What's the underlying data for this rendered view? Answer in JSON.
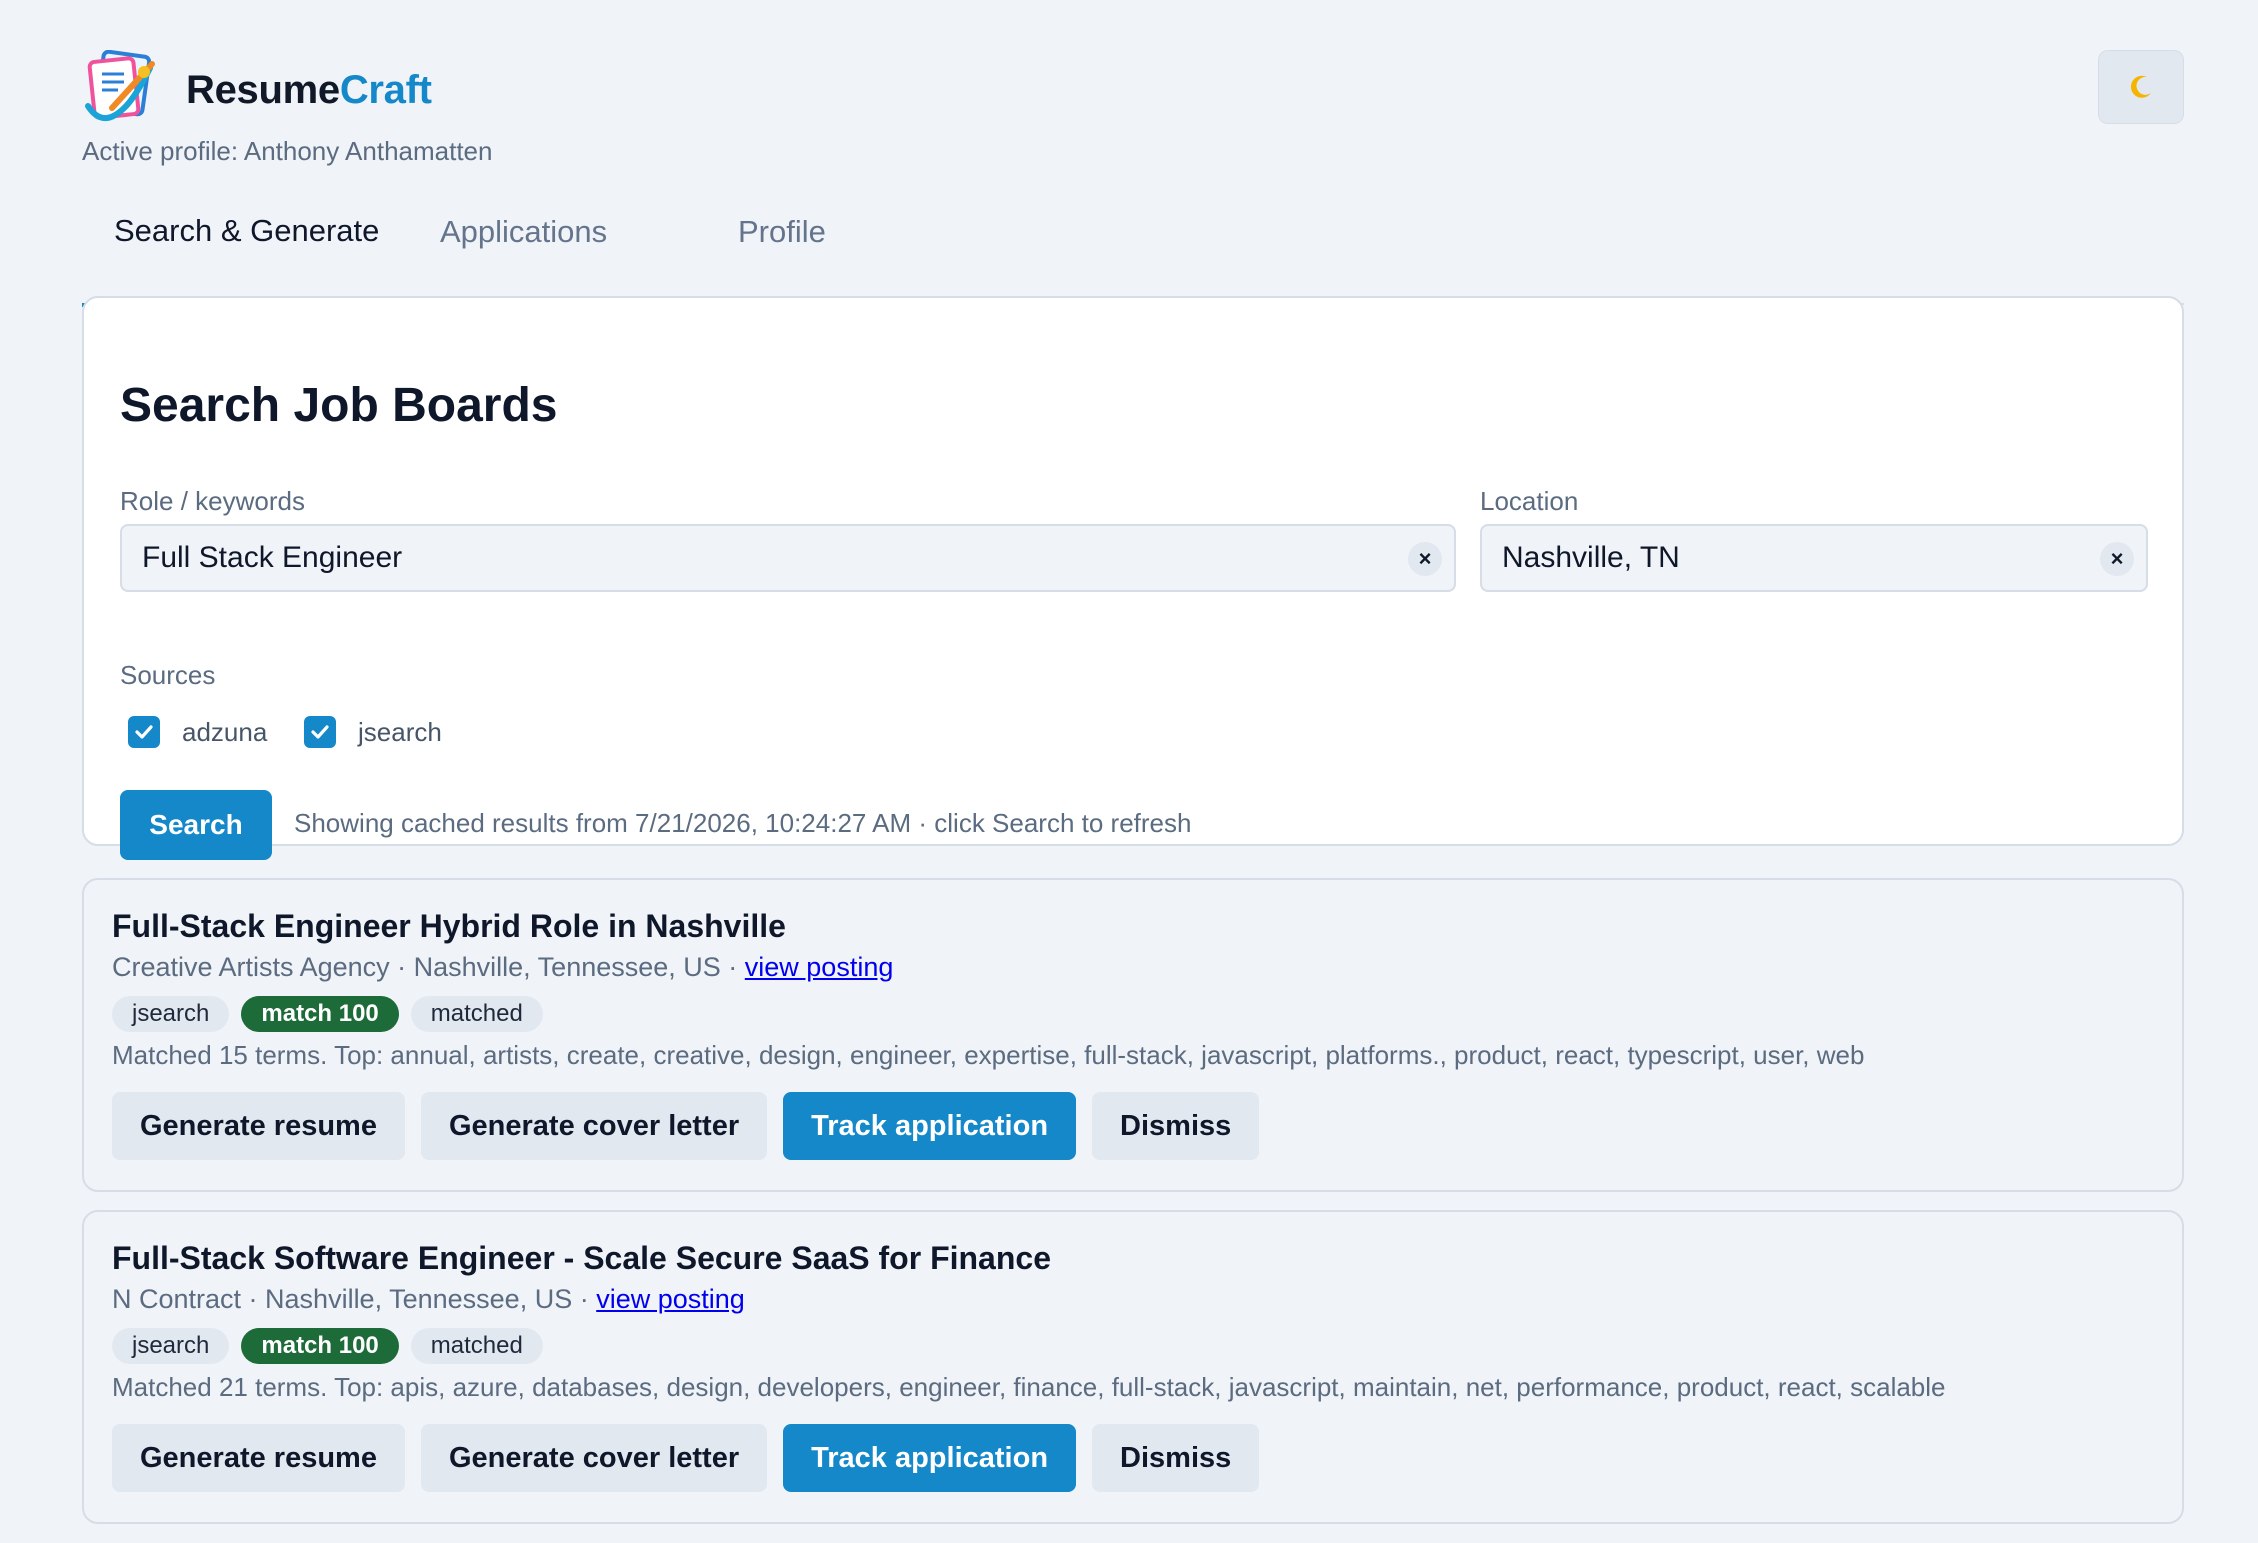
{
  "app": {
    "brand_part1": "Resume",
    "brand_part2": "Craft",
    "active_profile": "Active profile: Anthony Anthamatten",
    "theme_icon": "moon-icon"
  },
  "tabs": [
    {
      "label": "Search & Generate",
      "active": true
    },
    {
      "label": "Applications",
      "active": false
    },
    {
      "label": "Profile",
      "active": false
    }
  ],
  "search": {
    "title": "Search Job Boards",
    "role_label": "Role / keywords",
    "role_value": "Full Stack Engineer",
    "location_label": "Location",
    "location_value": "Nashville, TN",
    "sources_label": "Sources",
    "sources": [
      {
        "name": "adzuna",
        "checked": true
      },
      {
        "name": "jsearch",
        "checked": true
      }
    ],
    "search_button": "Search",
    "status": "Showing cached results from 7/21/2026, 10:24:27 AM · click Search to refresh"
  },
  "jobs": [
    {
      "title": "Full-Stack Engineer Hybrid Role in Nashville",
      "meta": "Creative Artists Agency · Nashville, Tennessee, US · ",
      "link": "view posting",
      "badges": [
        "jsearch",
        "match 100",
        "matched"
      ],
      "terms": "Matched 15 terms. Top: annual, artists, create, creative, design, engineer, expertise, full-stack, javascript, platforms., product, react, typescript, user, web",
      "actions": [
        "Generate resume",
        "Generate cover letter",
        "Track application",
        "Dismiss"
      ]
    },
    {
      "title": "Full-Stack Software Engineer - Scale Secure SaaS for Finance",
      "meta": "N Contract · Nashville, Tennessee, US · ",
      "link": "view posting",
      "badges": [
        "jsearch",
        "match 100",
        "matched"
      ],
      "terms": "Matched 21 terms. Top: apis, azure, databases, design, developers, engineer, finance, full-stack, javascript, maintain, net, performance, product, react, scalable",
      "actions": [
        "Generate resume",
        "Generate cover letter",
        "Track application",
        "Dismiss"
      ]
    }
  ],
  "colors": {
    "accent": "#1488c9",
    "match_badge": "#1e6b3a",
    "background": "#f0f3f8"
  }
}
